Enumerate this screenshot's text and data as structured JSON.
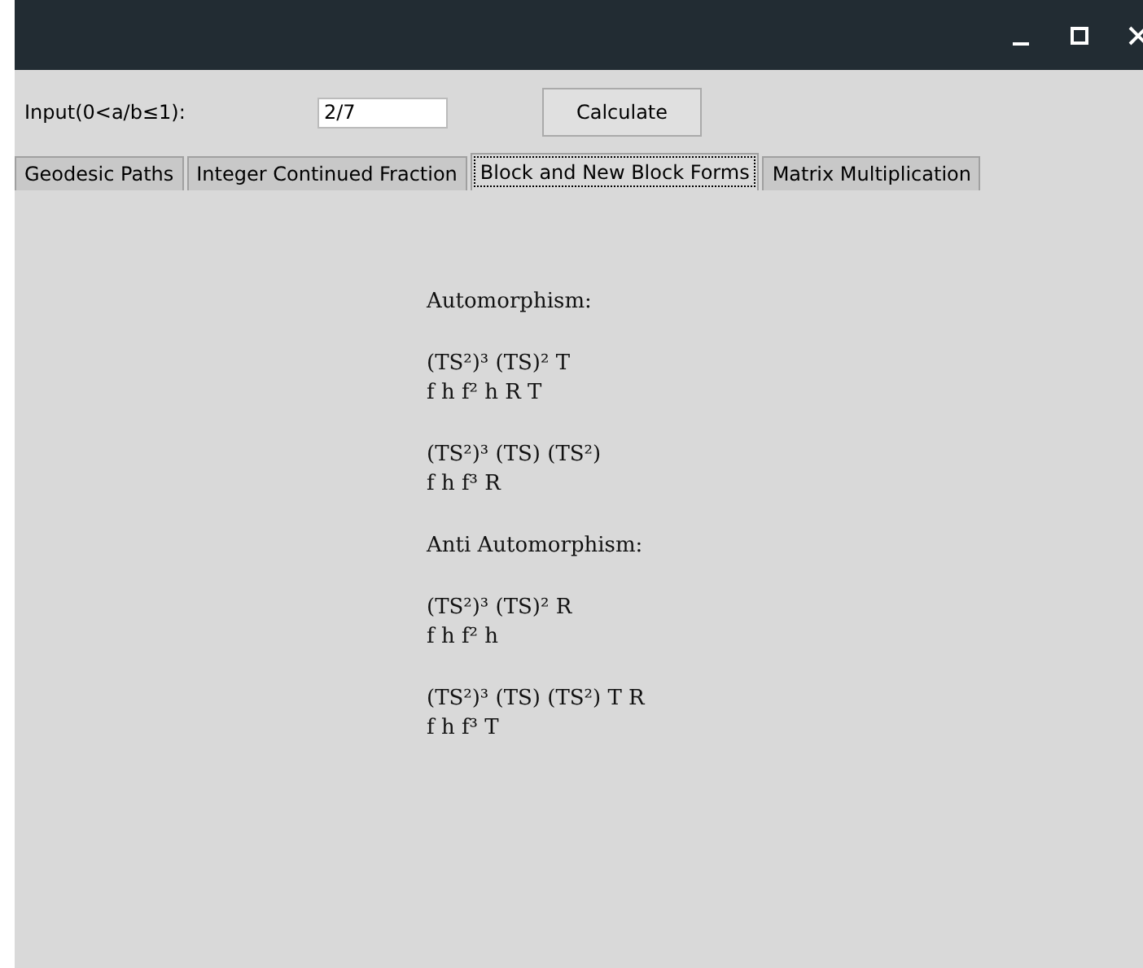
{
  "window": {
    "controls": [
      {
        "kind": "minimize"
      },
      {
        "kind": "maximize"
      },
      {
        "kind": "close"
      }
    ]
  },
  "input": {
    "label": "Input(0<a/b≤1):",
    "value": "2/7"
  },
  "calculate_button": "Calculate",
  "tabs": [
    {
      "label": "Geodesic Paths",
      "selected": false
    },
    {
      "label": "Integer Continued Fraction",
      "selected": false
    },
    {
      "label": "Block and New Block Forms",
      "selected": true
    },
    {
      "label": "Matrix Multiplication",
      "selected": false
    }
  ],
  "result_blocks": [
    [
      "Automorphism:"
    ],
    [
      "(TS²)³ (TS)² T",
      "f h f² h R T"
    ],
    [
      "(TS²)³ (TS) (TS²)",
      "f h f³ R"
    ],
    [
      "Anti Automorphism:"
    ],
    [
      "(TS²)³ (TS)² R",
      "f h f² h"
    ],
    [
      "(TS²)³ (TS) (TS²) T R",
      "f h f³ T"
    ]
  ]
}
